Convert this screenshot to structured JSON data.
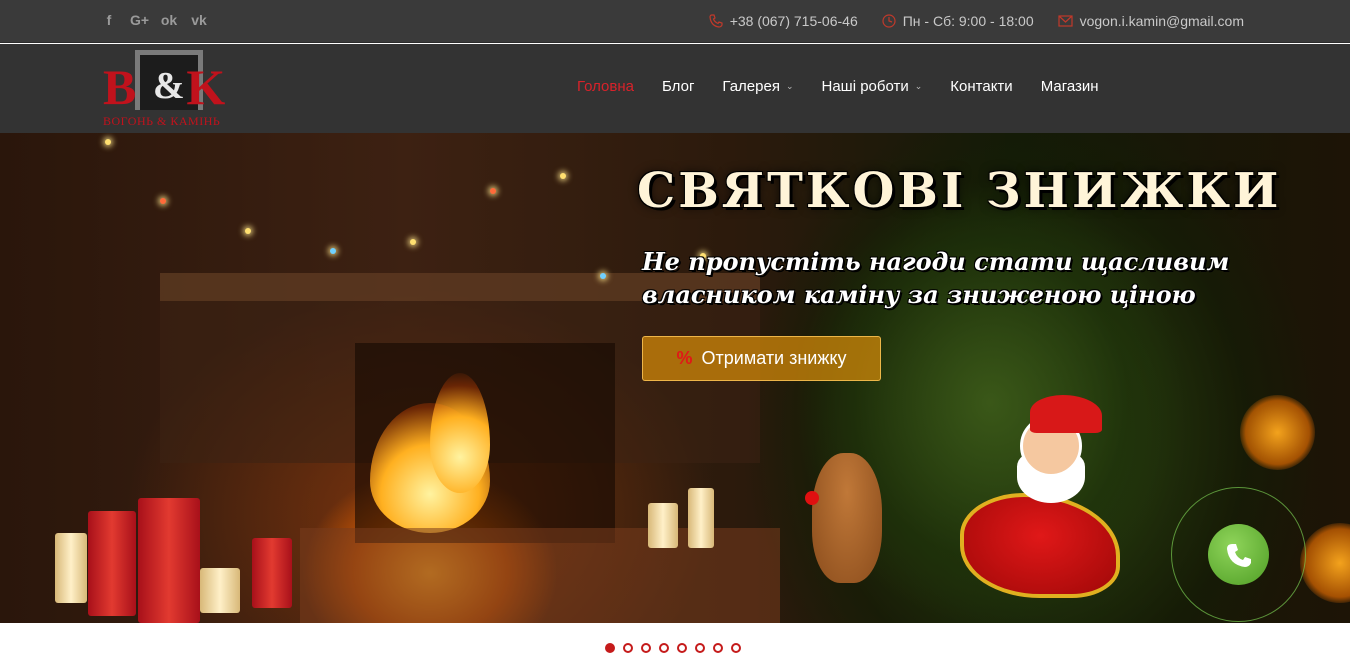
{
  "social": {
    "facebook_glyph": "f",
    "google_glyph": "G+",
    "odnoklassniki_glyph": "ok",
    "vk_glyph": "vk"
  },
  "contacts": {
    "phone": "+38 (067) 715-06-46",
    "hours": "Пн - Сб: 9:00 - 18:00",
    "email": "vogon.i.kamin@gmail.com"
  },
  "logo": {
    "left_letter": "B",
    "ampersand": "&",
    "right_letter": "K",
    "subtitle": "ВОГОНЬ & КАМІНЬ"
  },
  "menu": {
    "items": [
      {
        "label": "Головна",
        "active": true
      },
      {
        "label": "Блог"
      },
      {
        "label": "Галерея",
        "has_dropdown": true
      },
      {
        "label": "Наші роботи",
        "has_dropdown": true
      },
      {
        "label": "Контакти"
      },
      {
        "label": "Магазин"
      }
    ],
    "chevron": "⌄"
  },
  "hero": {
    "headline": "СВЯТКОВІ ЗНИЖКИ",
    "subline": "Не пропустіть нагоди стати щасливим власником каміну за зниженою ціною",
    "cta_icon": "%",
    "cta_label": "Отримати знижку"
  },
  "slider": {
    "slide_count": 8,
    "active_index": 0
  },
  "colors": {
    "accent": "#c51b1b",
    "topbar": "#3a3a3a",
    "navbar": "#333333",
    "cta": "#d78c0a",
    "phone_green": "#5fae30"
  }
}
